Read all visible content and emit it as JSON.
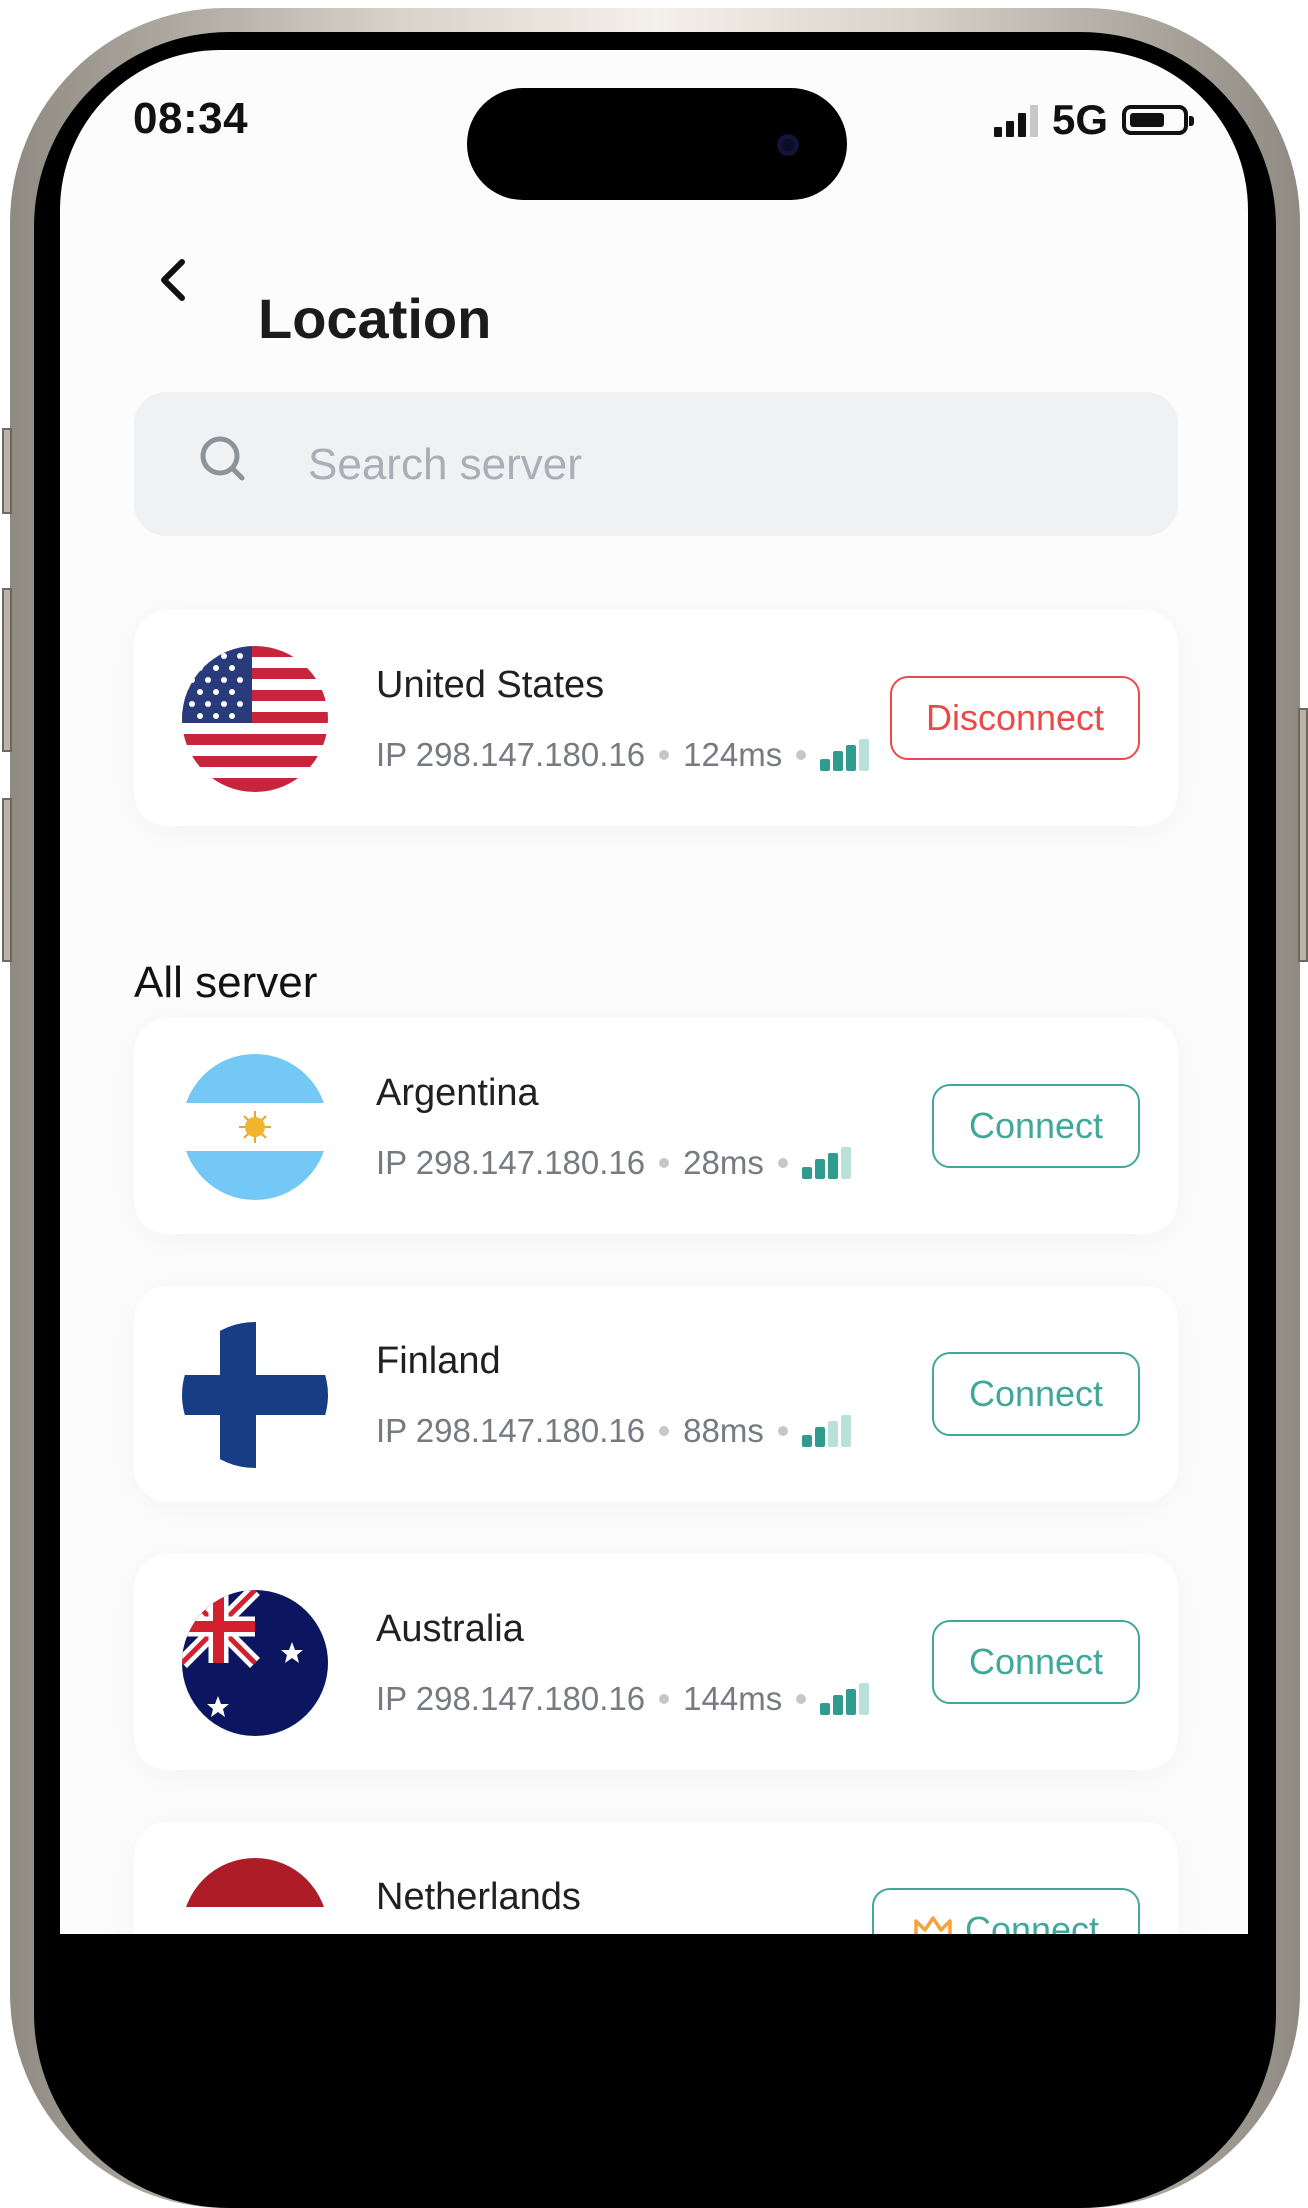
{
  "status_bar": {
    "time": "08:34",
    "network": "5G"
  },
  "header": {
    "title": "Location",
    "back_icon": "chevron-left-icon"
  },
  "search": {
    "placeholder": "Search server",
    "icon": "search-icon"
  },
  "connected": {
    "country": "United States",
    "ip": "IP 298.147.180.16",
    "latency": "124ms",
    "signal_strength": 3,
    "action_label": "Disconnect",
    "action_color": "#ec4a4a"
  },
  "all_server": {
    "heading": "All server",
    "items": [
      {
        "country": "Argentina",
        "ip": "IP 298.147.180.16",
        "latency": "28ms",
        "signal_strength": 3,
        "action_label": "Connect"
      },
      {
        "country": "Finland",
        "ip": "IP 298.147.180.16",
        "latency": "88ms",
        "signal_strength": 2,
        "action_label": "Connect"
      },
      {
        "country": "Australia",
        "ip": "IP 298.147.180.16",
        "latency": "144ms",
        "signal_strength": 3,
        "action_label": "Connect"
      },
      {
        "country": "Netherlands",
        "action_label": "Connect",
        "premium_icon": "crown-icon"
      }
    ]
  },
  "colors": {
    "accent": "#41a79a",
    "danger": "#ec4a4a",
    "signal_on": "#2f9c8f",
    "signal_off": "#b8e1da"
  }
}
